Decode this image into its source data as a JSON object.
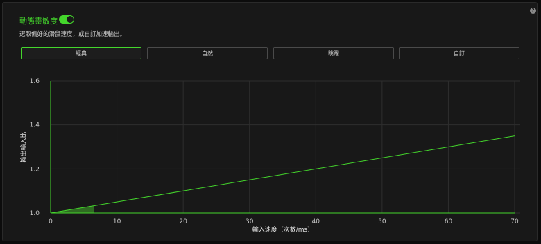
{
  "header": {
    "title": "動態靈敏度",
    "toggle_on": true,
    "description": "選取偏好的滑鼠速度，或自訂加速輸出。",
    "help_icon": "question-icon",
    "help_glyph": "?"
  },
  "presets": [
    {
      "label": "經典",
      "active": true
    },
    {
      "label": "自然",
      "active": false
    },
    {
      "label": "跳躍",
      "active": false
    },
    {
      "label": "自訂",
      "active": false
    }
  ],
  "colors": {
    "accent": "#44d62c",
    "grid": "#2e2e2e",
    "fill": "#2f6b22"
  },
  "chart_data": {
    "type": "line",
    "xlabel": "輸入速度（次數/ms）",
    "ylabel": "輸出輸入比",
    "xlim": [
      0,
      70
    ],
    "ylim": [
      1.0,
      1.6
    ],
    "xticks": [
      "0",
      "10",
      "20",
      "30",
      "40",
      "50",
      "60",
      "70"
    ],
    "yticks": [
      "1.0",
      "1.2",
      "1.4",
      "1.6"
    ],
    "grid": true,
    "series": [
      {
        "x": [
          0,
          70
        ],
        "y": [
          1.0,
          1.35
        ]
      }
    ],
    "highlight": {
      "x": [
        0,
        6.5
      ]
    }
  }
}
